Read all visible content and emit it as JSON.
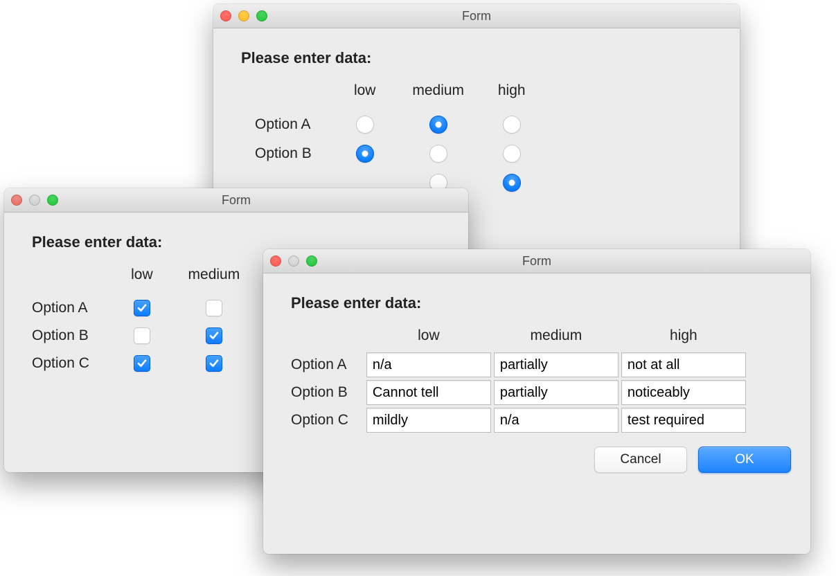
{
  "windows": {
    "radio": {
      "title": "Form",
      "prompt": "Please enter data:",
      "columns": [
        "low",
        "medium",
        "high"
      ],
      "rows": [
        "Option A",
        "Option B"
      ],
      "extra_row_visible": true,
      "selections": {
        "Option A": "medium",
        "Option B": "low",
        "partial_third_row": "high"
      }
    },
    "checkbox": {
      "title": "Form",
      "prompt": "Please enter data:",
      "columns": [
        "low",
        "medium"
      ],
      "rows": [
        "Option A",
        "Option B",
        "Option C"
      ],
      "checked": {
        "Option A": {
          "low": true,
          "medium": false
        },
        "Option B": {
          "low": false,
          "medium": true
        },
        "Option C": {
          "low": true,
          "medium": true
        }
      }
    },
    "text": {
      "title": "Form",
      "prompt": "Please enter data:",
      "columns": [
        "low",
        "medium",
        "high"
      ],
      "rows": [
        "Option A",
        "Option B",
        "Option C"
      ],
      "values": {
        "Option A": {
          "low": "n/a",
          "medium": "partially",
          "high": "not at all"
        },
        "Option B": {
          "low": "Cannot tell",
          "medium": "partially",
          "high": "noticeably"
        },
        "Option C": {
          "low": "mildly",
          "medium": "n/a",
          "high": "test required"
        }
      },
      "buttons": {
        "cancel": "Cancel",
        "ok": "OK"
      }
    }
  }
}
